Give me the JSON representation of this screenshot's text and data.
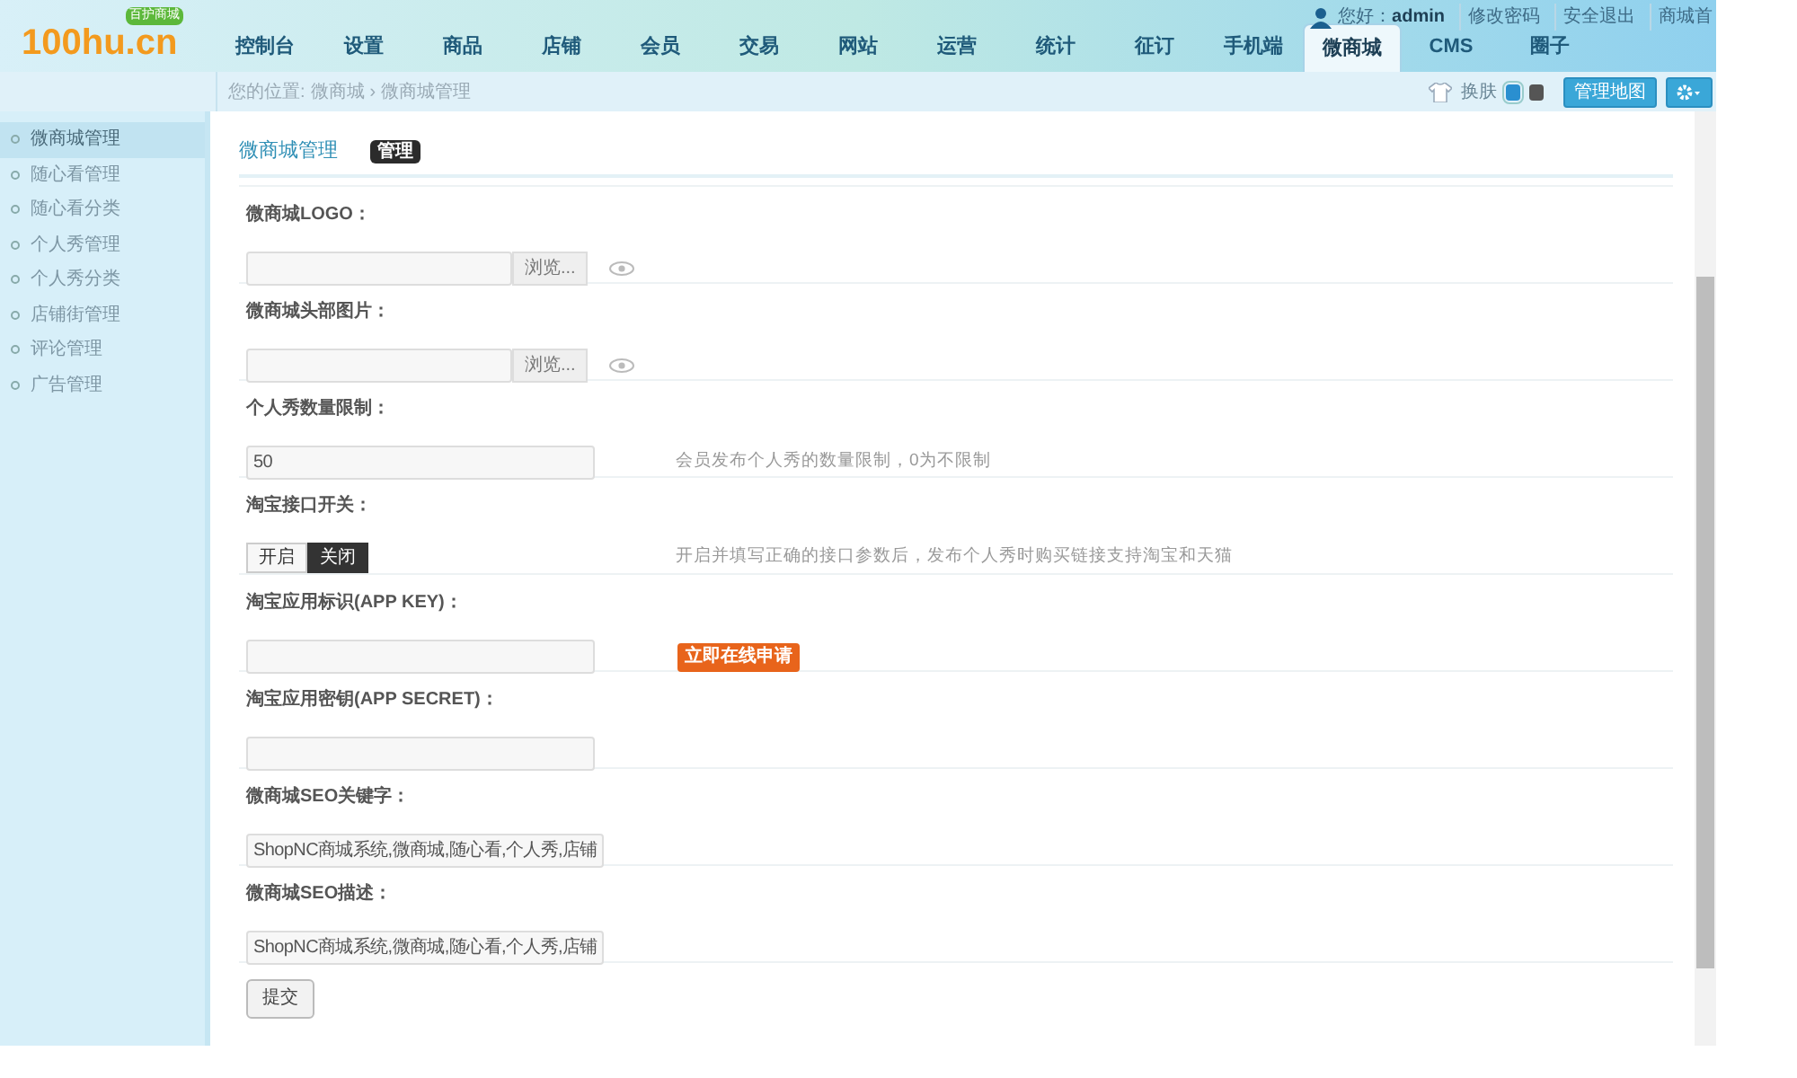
{
  "header": {
    "logo": "100hu.cn",
    "logo_badge": "百护商城",
    "nav": [
      {
        "label": "控制台",
        "selected": false
      },
      {
        "label": "设置",
        "selected": false
      },
      {
        "label": "商品",
        "selected": false
      },
      {
        "label": "店铺",
        "selected": false
      },
      {
        "label": "会员",
        "selected": false
      },
      {
        "label": "交易",
        "selected": false
      },
      {
        "label": "网站",
        "selected": false
      },
      {
        "label": "运营",
        "selected": false
      },
      {
        "label": "统计",
        "selected": false
      },
      {
        "label": "征订",
        "selected": false
      },
      {
        "label": "手机端",
        "selected": false
      },
      {
        "label": "微商城",
        "selected": true
      },
      {
        "label": "CMS",
        "selected": false
      },
      {
        "label": "圈子",
        "selected": false
      }
    ],
    "greeting": "您好：",
    "username": "admin",
    "links": [
      "修改密码",
      "安全退出",
      "商城首"
    ]
  },
  "breadcrumb": {
    "label": "您的位置:",
    "items": [
      "微商城",
      "微商城管理"
    ],
    "separator": "›"
  },
  "toolbar": {
    "skin": "换肤",
    "skins": [
      {
        "color": "#2a8fd0",
        "selected": true
      },
      {
        "color": "#555555",
        "selected": false
      }
    ],
    "map_button": "管理地图"
  },
  "sidebar": {
    "items": [
      {
        "label": "微商城管理",
        "selected": true
      },
      {
        "label": "随心看管理",
        "selected": false
      },
      {
        "label": "随心看分类",
        "selected": false
      },
      {
        "label": "个人秀管理",
        "selected": false
      },
      {
        "label": "个人秀分类",
        "selected": false
      },
      {
        "label": "店铺街管理",
        "selected": false
      },
      {
        "label": "评论管理",
        "selected": false
      },
      {
        "label": "广告管理",
        "selected": false
      }
    ]
  },
  "content": {
    "title": "微商城管理",
    "tab": "管理",
    "fields": [
      {
        "kind": "file",
        "label": "微商城LOGO：",
        "button": "浏览..."
      },
      {
        "kind": "file",
        "label": "微商城头部图片：",
        "button": "浏览..."
      },
      {
        "kind": "text",
        "label": "个人秀数量限制：",
        "value": "50",
        "hint": "会员发布个人秀的数量限制，0为不限制"
      },
      {
        "kind": "toggle",
        "label": "淘宝接口开关：",
        "options": [
          {
            "label": "开启",
            "selected": false
          },
          {
            "label": "关闭",
            "selected": true
          }
        ],
        "hint": "开启并填写正确的接口参数后，发布个人秀时购买链接支持淘宝和天猫"
      },
      {
        "kind": "text",
        "label": "淘宝应用标识(APP KEY)：",
        "action": "立即在线申请"
      },
      {
        "kind": "text",
        "label": "淘宝应用密钥(APP SECRET)："
      },
      {
        "kind": "text",
        "label": "微商城SEO关键字：",
        "value": "ShopNC商城系统,微商城,随心看,个人秀,店铺"
      },
      {
        "kind": "text",
        "label": "微商城SEO描述：",
        "value": "ShopNC商城系统,微商城,随心看,个人秀,店铺"
      }
    ],
    "submit": "提交"
  }
}
